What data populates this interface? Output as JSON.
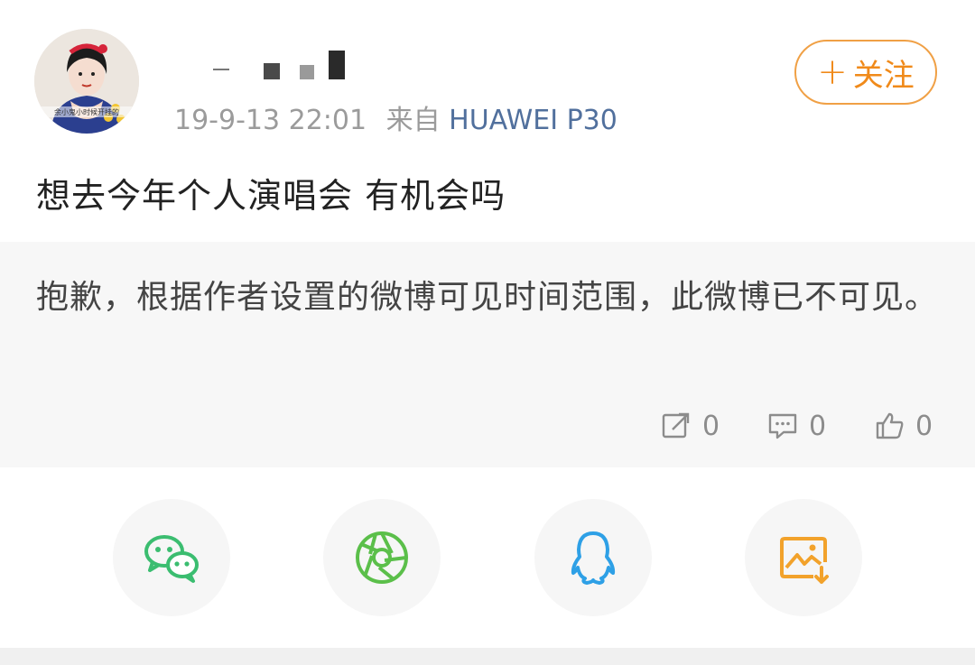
{
  "post": {
    "timestamp": "19-9-13 22:01",
    "source_prefix": "来自",
    "device": "HUAWEI P30",
    "follow_label": "关注",
    "follow_plus": "+",
    "text": "想去今年个人演唱会 有机会吗",
    "avatar_caption": "余小鬼小时候开挂的"
  },
  "repost": {
    "notice": "抱歉，根据作者设置的微博可见时间范围，此微博已不可见。",
    "repost_count": "0",
    "comment_count": "0",
    "like_count": "0"
  },
  "share": {
    "items": [
      {
        "name": "wechat",
        "color": "#3bbd70"
      },
      {
        "name": "moments",
        "color": "#5bbf4a"
      },
      {
        "name": "qq",
        "color": "#2ea0e6"
      },
      {
        "name": "save-image",
        "color": "#f2a22b"
      }
    ]
  },
  "colors": {
    "accent": "#f08a1a",
    "device_link": "#51709d",
    "repost_bg": "#f7f7f7"
  }
}
